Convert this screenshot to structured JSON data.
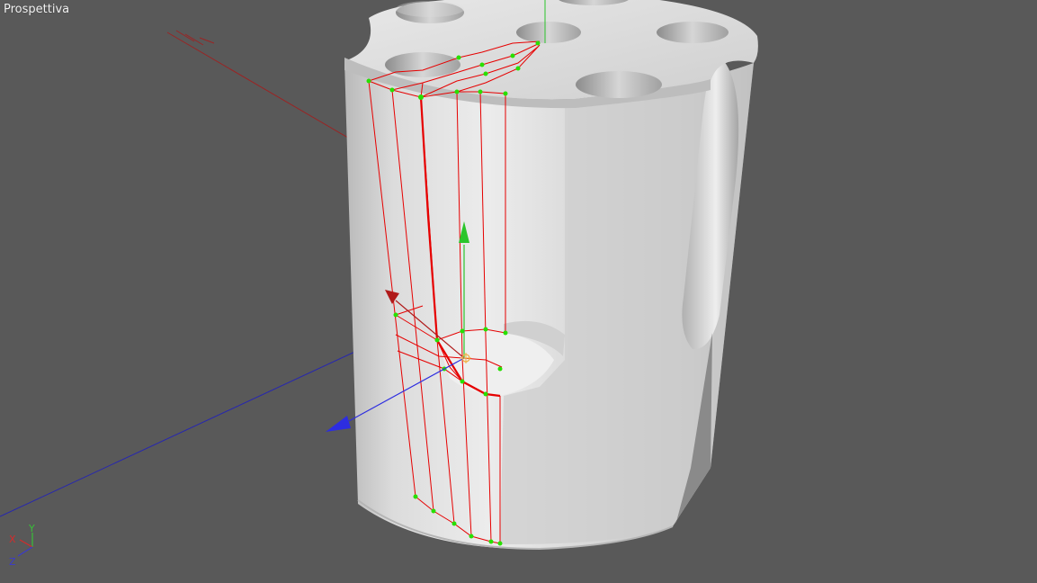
{
  "viewport": {
    "title": "Prospettiva",
    "background": "#595959"
  },
  "axis_indicator": {
    "x_label": "X",
    "y_label": "Y",
    "z_label": "Z",
    "x_color": "#d22c2c",
    "y_color": "#38c038",
    "z_color": "#3a3acc"
  },
  "colors": {
    "object_light": "#e4e4e4",
    "object_mid": "#c9c9c9",
    "object_dark": "#a8a8a8",
    "wire": "#e60000",
    "vertex": "#27e000",
    "gizmo_x": "#b01a1a",
    "gizmo_y": "#2bc52b",
    "gizmo_z": "#2d2de0",
    "world_x_axis": "#9a2424",
    "world_z_axis": "#2626b0"
  },
  "icons": {
    "move_gizmo": "move-gizmo-icon",
    "axis_triad": "axis-triad-icon"
  }
}
